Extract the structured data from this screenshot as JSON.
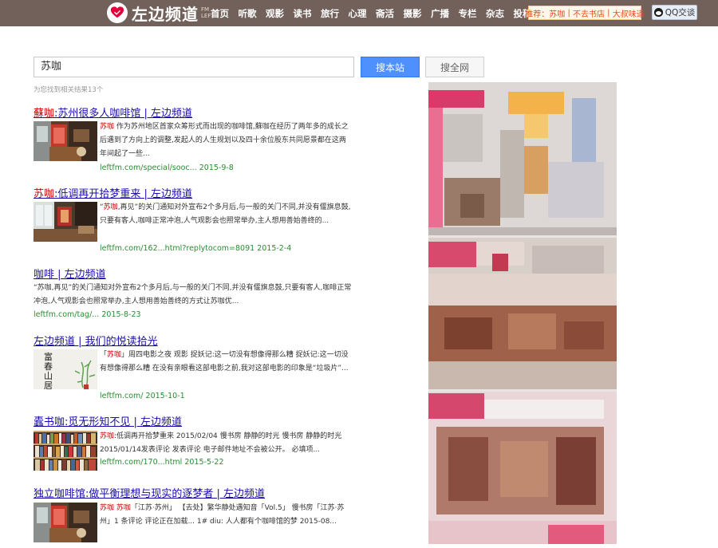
{
  "header": {
    "logo_text": "左边频道",
    "logo_sub": "FM LEFT",
    "nav": [
      "首页",
      "听歌",
      "观影",
      "读书",
      "旅行",
      "心理",
      "斋活",
      "摄影",
      "广播",
      "专栏",
      "杂志",
      "投稿"
    ],
    "recommend_prefix": "推荐：",
    "recommend_links": [
      "苏咖",
      "不去书店",
      "大叔味道"
    ],
    "qq_label": "QQ交谈",
    "colors": {
      "bar": "#72605a",
      "accent": "#e2501e"
    }
  },
  "search": {
    "query": "苏咖",
    "site_button": "搜本站",
    "web_button": "搜全网",
    "result_count": "为您找到相关结果13个"
  },
  "results": [
    {
      "title_hl": "蘇咖",
      "title_rest": ":苏州很多人咖啡馆 | 左边频道",
      "snippet_hl": "苏咖",
      "snippet": " 作为苏州地区首家众筹形式而出现的咖啡馆,蘇咖在经历了两年多的成长之后遇到了方向上的调整,发起人的人生规划以及四十余位股东共同愿景都在这两年间起了一些...",
      "url": "leftfm.com/special/sooc...",
      "date": "2015-9-8",
      "thumb_icon": "cafe-interior-photo"
    },
    {
      "title_hl": "苏咖",
      "title_rest": ":低调再开拾梦重来 | 左边频道",
      "snippet_pre": "“",
      "snippet_hl": "苏咖",
      "snippet": ",再见”的关门通知对外宣布2个多月后,与一般的关门不同,并没有偃旗息鼓,只要有客人,咖啡正常冲泡,人气观影会也照常举办,主人想用善始善终的...",
      "url": "leftfm.com/162...html?replytocom=8091",
      "date": "2015-2-4",
      "thumb_icon": "cafe-window-photo"
    },
    {
      "title_hl": "咖啡",
      "title_rest": " | 左边频道",
      "snippet_pre": "“苏咖,再见”的关门通知对外宣布2个多月后,与一般的关门不同,并没有偃旗息鼓,只要有客人,咖啡正常冲泡,人气观影会也照常举办,主人想用善始善终的方式让",
      "snippet_hl": "苏咖",
      "snippet": "优...",
      "url": "leftfm.com/tag/...",
      "date": "2015-8-23"
    },
    {
      "title_hl": "",
      "title_rest": "左边频道 | 我们的悦读拾光",
      "snippet_pre": "「",
      "snippet_hl": "苏咖",
      "snippet": "」周四电影之夜 观影 捉妖记:这一切没有想像得那么糟 捉妖记:这一切没有想像得那么糟 在没有亲眼看这部电影之前,我对这部电影的印象是“垃圾片”...",
      "url": "leftfm.com/",
      "date": "2015-10-1",
      "thumb_icon": "fushan-poster",
      "thumb_text": "富春山居"
    },
    {
      "title_hl": "",
      "title_rest": "蠹书咖:觅无形知不见 | 左边频道",
      "snippet_hl": "苏咖",
      "snippet": ":低调再开拾梦重来 2015/02/04 慢书房 静静的时光 慢书房 静静的时光 2015/01/14发表评论 发表评论 电子邮件地址不会被公开。 必填项...",
      "url": "leftfm.com/170...html",
      "date": "2015-5-22",
      "thumb_icon": "bookshelf-photo"
    },
    {
      "title_hl": "",
      "title_rest": "独立咖啡馆:做平衡理想与现实的逐梦者 | 左边频道",
      "snippet_hl": "苏咖",
      "snippet_hl2": "苏咖",
      "snippet": "「江苏·苏州」1 条评论 评论正在加载... 1# diu: 人人都有个咖啡馆的梦 2015-08...",
      "snippet_mid": "「江苏·苏州」 【去处】繁华静处遇知音「Vol.5」 慢书房「江苏·苏州」1 条评论 评论正在加载... 1# diu: 人人都有个咖啡馆的梦 2015-08...",
      "thumb_icon": "cafe-interior-photo"
    }
  ],
  "sidebar": {
    "ad_icon": "advertisement-pixelated-image"
  }
}
